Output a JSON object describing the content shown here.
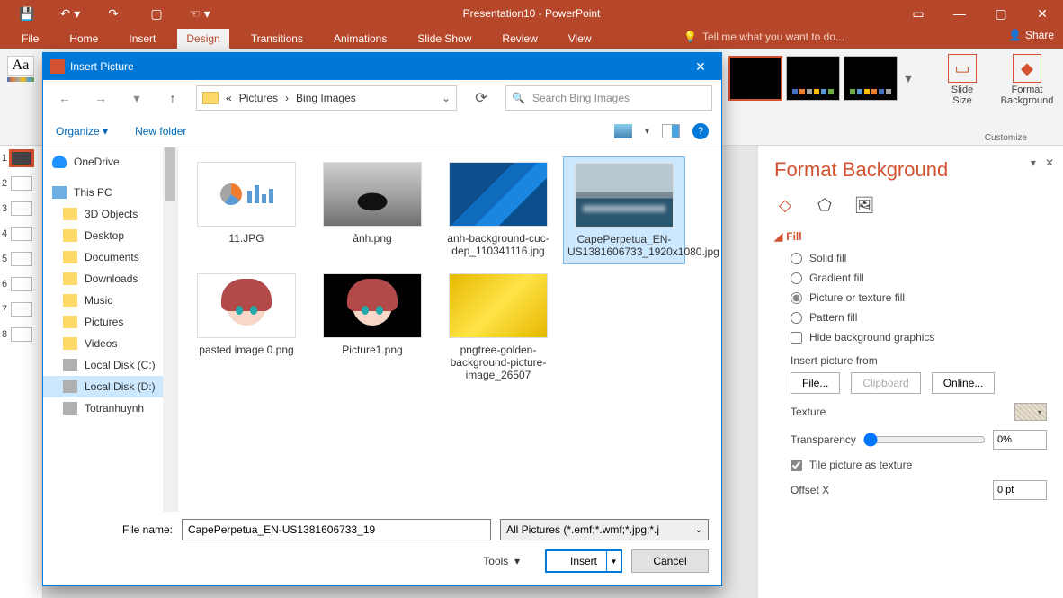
{
  "app": {
    "title": "Presentation10 - PowerPoint",
    "qat": [
      "save",
      "undo",
      "redo",
      "present",
      "touch"
    ],
    "wincontrols": {
      "ribbon_opts": "▢",
      "min": "—",
      "max": "▢",
      "close": "✕"
    }
  },
  "ribbon": {
    "tabs": [
      "File",
      "Home",
      "Insert",
      "Design",
      "Transitions",
      "Animations",
      "Slide Show",
      "Review",
      "View"
    ],
    "active_tab": "Design",
    "tell_me": "Tell me what you want to do...",
    "share": "Share",
    "customize": {
      "slide_size": "Slide\nSize",
      "format_bg": "Format\nBackground",
      "group_label": "Customize"
    }
  },
  "thumbs": [
    1,
    2,
    3,
    4,
    5,
    6,
    7,
    8
  ],
  "format_bg": {
    "title": "Format Background",
    "section": "Fill",
    "radios": {
      "solid": "Solid fill",
      "gradient": "Gradient fill",
      "picture": "Picture or texture fill",
      "pattern": "Pattern fill"
    },
    "selected_radio": "picture",
    "hide_bg": "Hide background graphics",
    "insert_from": "Insert picture from",
    "buttons": {
      "file": "File...",
      "clipboard": "Clipboard",
      "online": "Online..."
    },
    "texture": "Texture",
    "transparency": "Transparency",
    "transparency_value": "0%",
    "tile": "Tile picture as texture",
    "tile_checked": true,
    "offset_x": "Offset X",
    "offset_x_value": "0 pt"
  },
  "dialog": {
    "title": "Insert Picture",
    "breadcrumb": {
      "prefix": "«",
      "parts": [
        "Pictures",
        "Bing Images"
      ]
    },
    "search_placeholder": "Search Bing Images",
    "toolbar": {
      "organize": "Organize",
      "new_folder": "New folder"
    },
    "tree": [
      {
        "label": "OneDrive",
        "icon": "cloud",
        "indent": false
      },
      {
        "label": "This PC",
        "icon": "pc",
        "indent": false
      },
      {
        "label": "3D Objects",
        "icon": "folder",
        "indent": true
      },
      {
        "label": "Desktop",
        "icon": "folder",
        "indent": true
      },
      {
        "label": "Documents",
        "icon": "folder",
        "indent": true
      },
      {
        "label": "Downloads",
        "icon": "folder",
        "indent": true
      },
      {
        "label": "Music",
        "icon": "folder",
        "indent": true
      },
      {
        "label": "Pictures",
        "icon": "folder",
        "indent": true
      },
      {
        "label": "Videos",
        "icon": "folder",
        "indent": true
      },
      {
        "label": "Local Disk (C:)",
        "icon": "disk",
        "indent": true
      },
      {
        "label": "Local Disk (D:)",
        "icon": "disk",
        "indent": true,
        "selected": true
      },
      {
        "label": "Totranhuynh",
        "icon": "disk",
        "indent": true
      }
    ],
    "files": [
      {
        "name": "11.JPG",
        "thumb": "chart"
      },
      {
        "name": "ảnh.png",
        "thumb": "bw-photo"
      },
      {
        "name": "anh-background-cuc-dep_110341116.jpg",
        "thumb": "blue-abs"
      },
      {
        "name": "CapePerpetua_EN-US1381606733_1920x1080.jpg",
        "thumb": "coast",
        "selected": true
      },
      {
        "name": "pasted image 0.png",
        "thumb": "anime1"
      },
      {
        "name": "Picture1.png",
        "thumb": "anime2"
      },
      {
        "name": "pngtree-golden-background-picture-image_26507",
        "thumb": "golden"
      }
    ],
    "filename_label": "File name:",
    "filename_value": "CapePerpetua_EN-US1381606733_19",
    "filetype": "All Pictures (*.emf;*.wmf;*.jpg;*.j",
    "tools": "Tools",
    "insert": "Insert",
    "cancel": "Cancel"
  }
}
